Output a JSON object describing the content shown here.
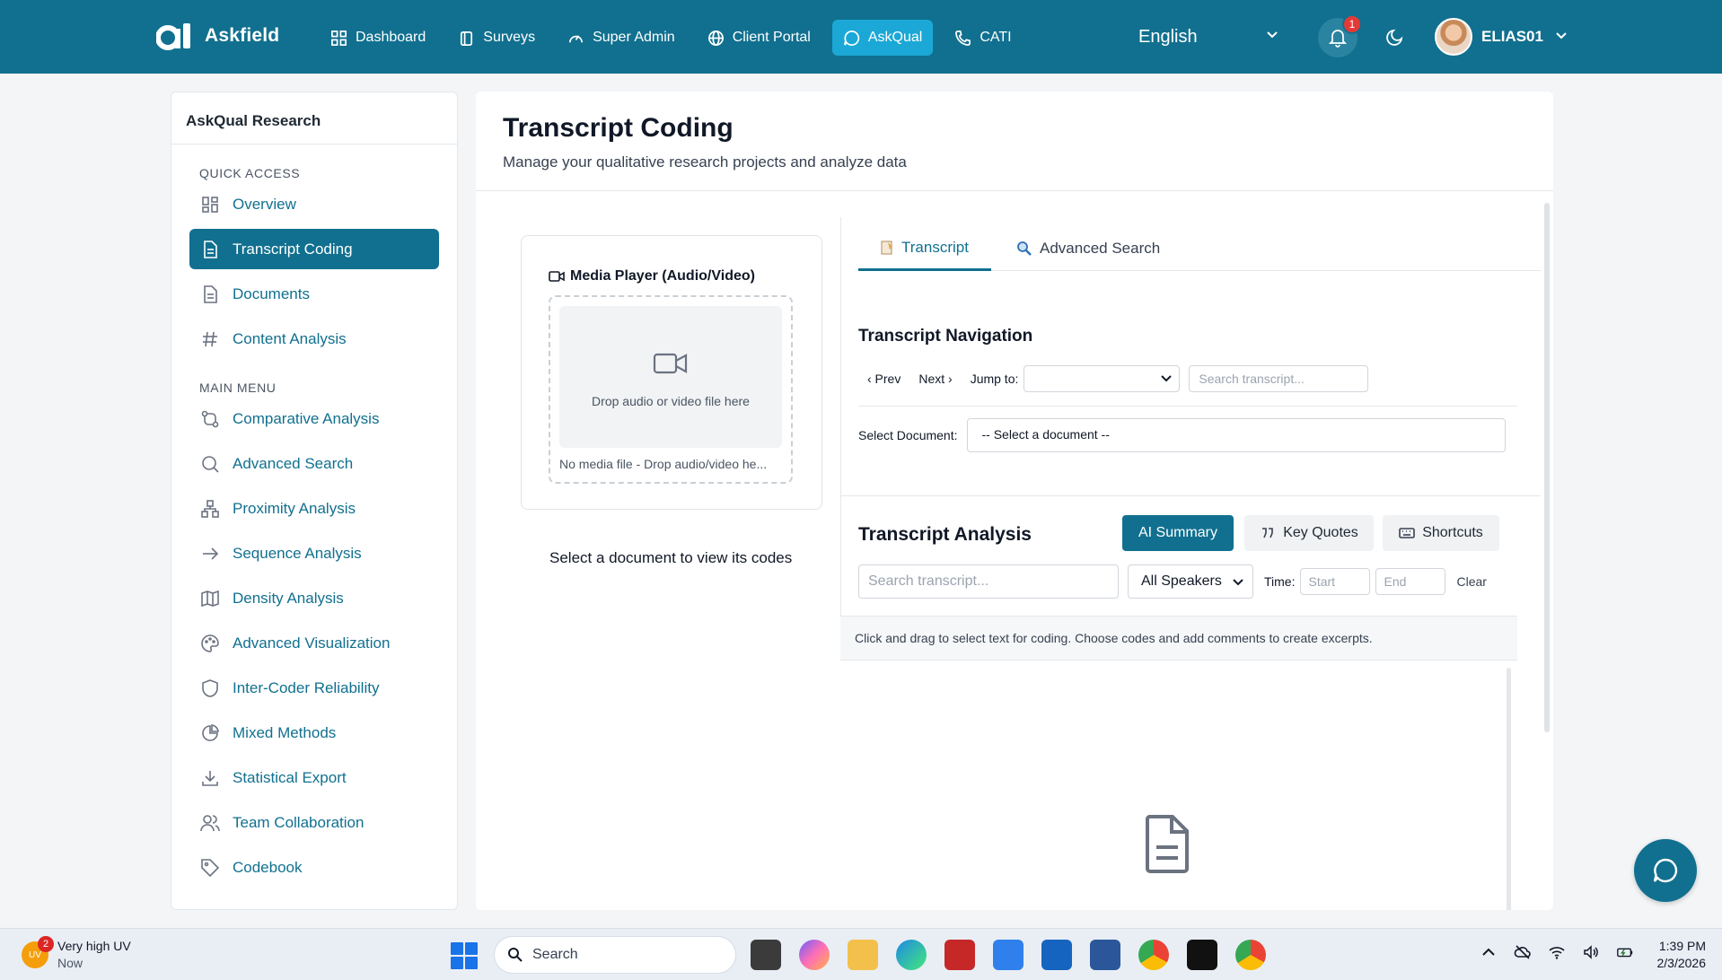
{
  "app": {
    "name": "Askfield",
    "nav": [
      {
        "label": "Dashboard",
        "icon": "grid-icon"
      },
      {
        "label": "Surveys",
        "icon": "clipboard-icon"
      },
      {
        "label": "Super Admin",
        "icon": "gauge-icon"
      },
      {
        "label": "Client Portal",
        "icon": "globe-icon"
      },
      {
        "label": "AskQual",
        "icon": "chat-icon",
        "active": true
      },
      {
        "label": "CATI",
        "icon": "phone-icon"
      }
    ],
    "language": "English",
    "notifications": "1",
    "username": "ELIAS01",
    "accent": "#11708f"
  },
  "sidebar": {
    "title": "AskQual Research",
    "quick_access_label": "QUICK ACCESS",
    "main_menu_label": "MAIN MENU",
    "quick": [
      {
        "label": "Overview"
      },
      {
        "label": "Transcript Coding",
        "active": true
      },
      {
        "label": "Documents"
      },
      {
        "label": "Content Analysis"
      }
    ],
    "main": [
      {
        "label": "Comparative Analysis"
      },
      {
        "label": "Advanced Search"
      },
      {
        "label": "Proximity Analysis"
      },
      {
        "label": "Sequence Analysis"
      },
      {
        "label": "Density Analysis"
      },
      {
        "label": "Advanced Visualization"
      },
      {
        "label": "Inter-Coder Reliability"
      },
      {
        "label": "Mixed Methods"
      },
      {
        "label": "Statistical Export"
      },
      {
        "label": "Team Collaboration"
      },
      {
        "label": "Codebook"
      }
    ]
  },
  "page": {
    "title": "Transcript Coding",
    "subtitle": "Manage your qualitative research projects and analyze data"
  },
  "media": {
    "title": "Media Player (Audio/Video)",
    "drop_text": "Drop audio or video file here",
    "no_media": "No media file - Drop audio/video he...",
    "select_doc_codes": "Select a document to view its codes"
  },
  "tabs": {
    "transcript": "Transcript",
    "advanced_search": "Advanced Search"
  },
  "navigation": {
    "title": "Transcript Navigation",
    "prev": "‹ Prev",
    "next": "Next ›",
    "jump_to": "Jump to:",
    "search_placeholder": "Search transcript...",
    "select_document_label": "Select Document:",
    "select_document_value": "-- Select a document --"
  },
  "analysis": {
    "title": "Transcript Analysis",
    "ai_summary": "AI Summary",
    "key_quotes": "Key Quotes",
    "shortcuts": "Shortcuts",
    "search_placeholder": "Search transcript...",
    "speakers": "All Speakers",
    "time_label": "Time:",
    "start_placeholder": "Start",
    "end_placeholder": "End",
    "clear": "Clear",
    "hint": "Click and drag to select text for coding. Choose codes and add comments to create excerpts."
  },
  "taskbar": {
    "weather_title": "Very high UV",
    "weather_sub": "Now",
    "uv_label": "UV",
    "uv_badge": "2",
    "search": "Search",
    "time": "1:39 PM",
    "date": "2/3/2026"
  }
}
